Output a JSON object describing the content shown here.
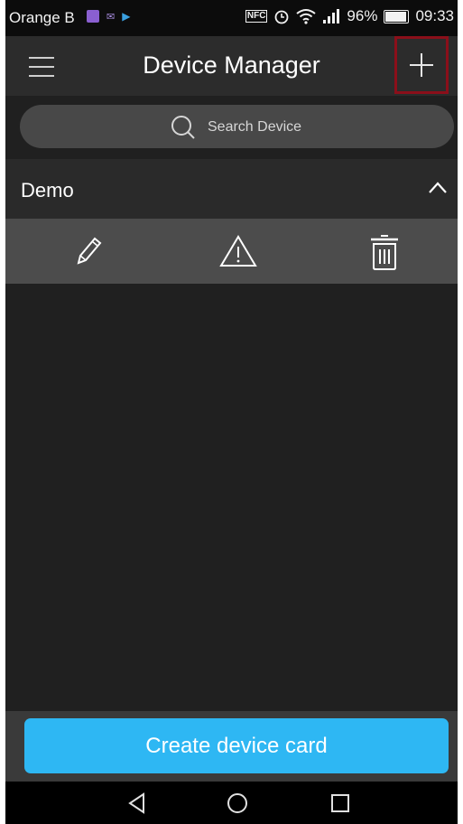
{
  "status_bar": {
    "carrier": "Orange B",
    "battery": "96%",
    "time": "09:33",
    "nfc_label": "NFC"
  },
  "header": {
    "title": "Device Manager",
    "menu_icon": "hamburger-icon",
    "add_icon": "plus-icon"
  },
  "search": {
    "placeholder": "Search Device"
  },
  "group": {
    "name": "Demo",
    "expanded": true,
    "actions": [
      "edit-icon",
      "alert-icon",
      "trash-icon"
    ]
  },
  "footer": {
    "create_label": "Create device card"
  },
  "colors": {
    "accent": "#2eb7f3",
    "highlight_border": "#8b0f1a",
    "background": "#202020"
  }
}
